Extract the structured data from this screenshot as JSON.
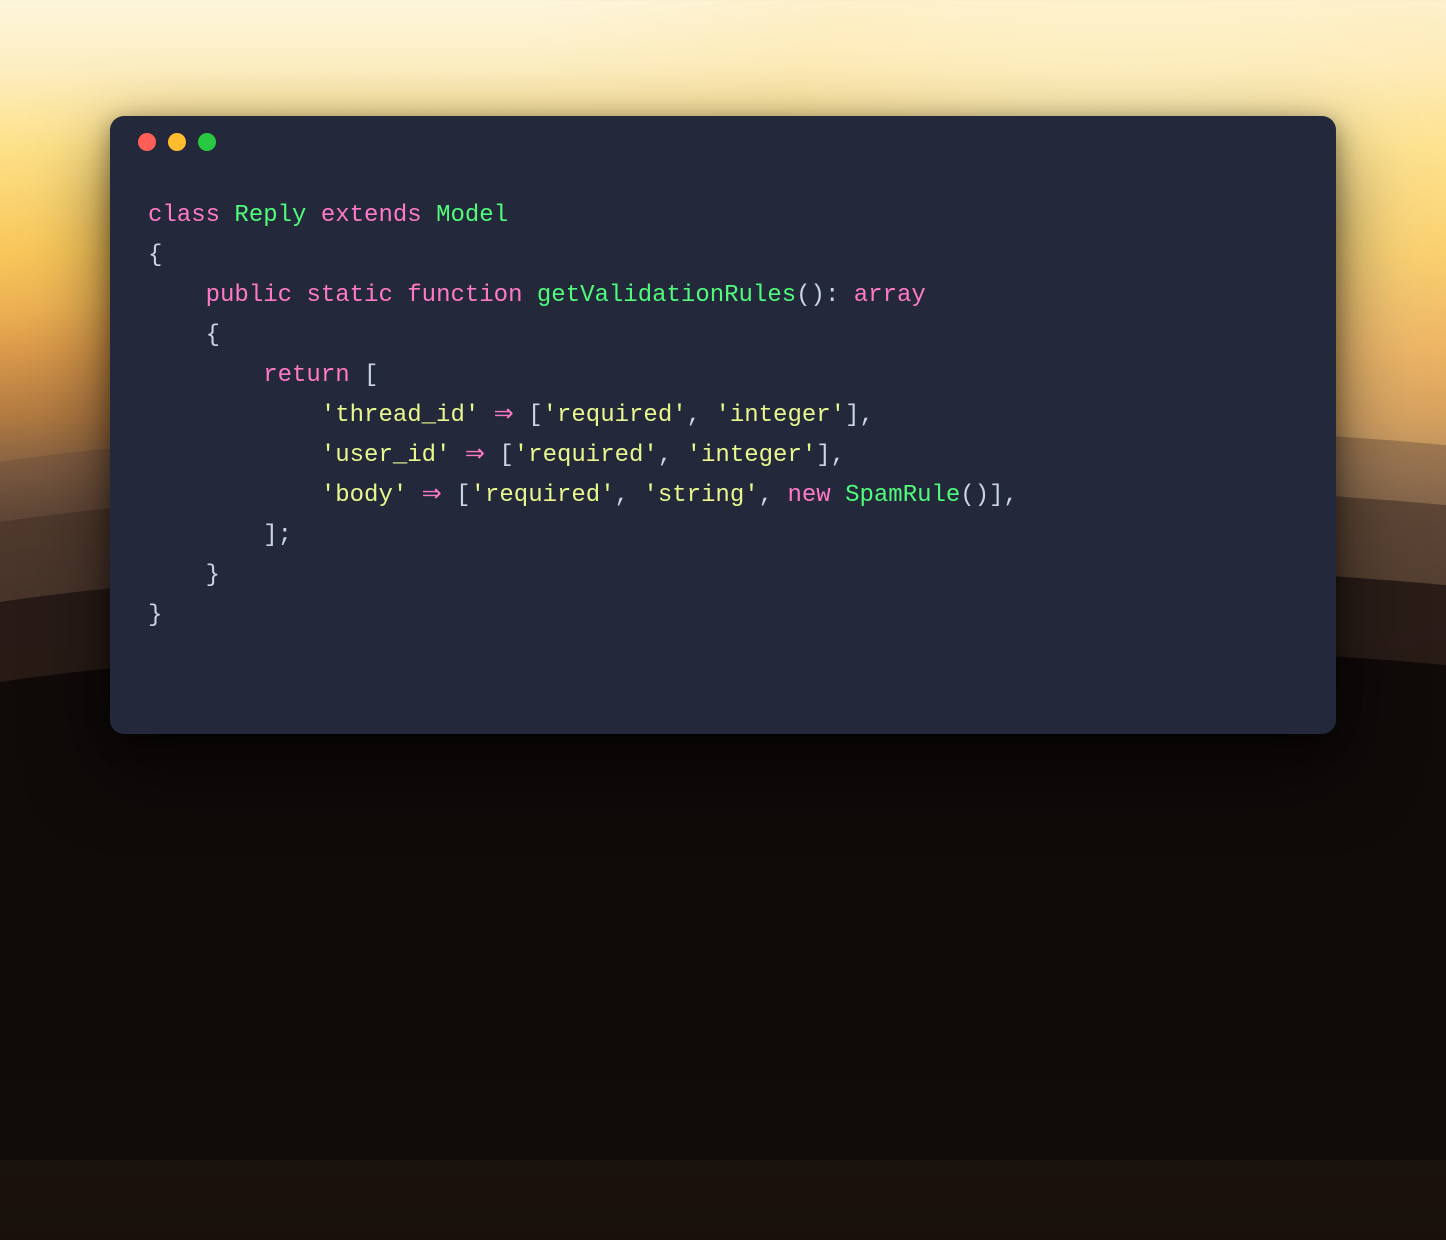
{
  "traffic_lights": {
    "close_color": "#ff5f57",
    "minimize_color": "#febc2e",
    "zoom_color": "#28c840"
  },
  "kw": {
    "class": "class",
    "extends": "extends",
    "public": "public",
    "static": "static",
    "function": "function",
    "return": "return",
    "new": "new"
  },
  "cls": {
    "Reply": "Reply",
    "Model": "Model",
    "getValidationRules": "getValidationRules",
    "SpamRule": "SpamRule"
  },
  "returnType": "array",
  "punct": {
    "lbrace": "{",
    "rbrace": "}",
    "lbracket": "[",
    "rbracket": "]",
    "lparen": "(",
    "rparen": ")",
    "colon": ":",
    "semicolon": ";",
    "comma": ",",
    "arrow": "⇒"
  },
  "rules": {
    "line1": {
      "key": "'thread_id'",
      "v1": "'required'",
      "v2": "'integer'"
    },
    "line2": {
      "key": "'user_id'",
      "v1": "'required'",
      "v2": "'integer'"
    },
    "line3": {
      "key": "'body'",
      "v1": "'required'",
      "v2": "'string'"
    }
  }
}
